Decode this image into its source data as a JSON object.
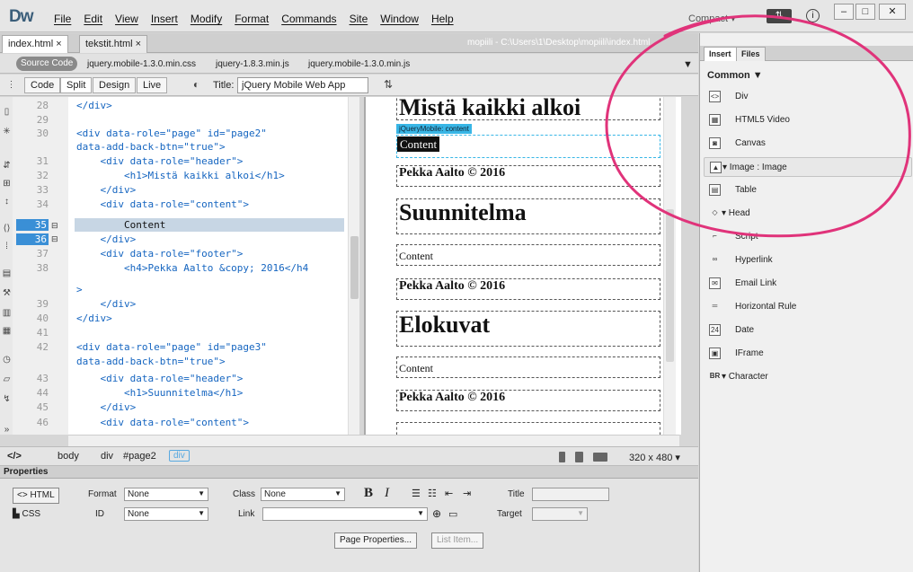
{
  "app": {
    "logo": "Dw",
    "menus": [
      "File",
      "Edit",
      "View",
      "Insert",
      "Modify",
      "Format",
      "Commands",
      "Site",
      "Window",
      "Help"
    ],
    "workspace": "Compact ▾",
    "sync": "⇅",
    "info": "i",
    "window_controls": [
      "–",
      "□",
      "✕"
    ]
  },
  "doc": {
    "tabs": [
      "index.html ×",
      "tekstit.html ×"
    ],
    "path": "mopiili - C:\\Users\\1\\Desktop\\mopiili\\index.html",
    "source_button": "Source Code",
    "related_files": [
      "jquery.mobile-1.3.0.min.css",
      "jquery-1.8.3.min.js",
      "jquery.mobile-1.3.0.min.js"
    ],
    "view_buttons": [
      "Code",
      "Split",
      "Design",
      "Live"
    ],
    "title_label": "Title:",
    "title_value": "jQuery Mobile Web App"
  },
  "code": {
    "line_numbers": [
      "28",
      "29",
      "30",
      "",
      "31",
      "32",
      "33",
      "34",
      "35",
      "36",
      "37",
      "38",
      "",
      "39",
      "40",
      "41",
      "42",
      "",
      "43",
      "44",
      "45",
      "46"
    ],
    "lines": [
      "</div>",
      "",
      "<div data-role=\"page\" id=\"page2\"",
      "data-add-back-btn=\"true\">",
      "    <div data-role=\"header\">",
      "        <h1>Mistä kaikki alkoi</h1>",
      "    </div>",
      "    <div data-role=\"content\">",
      "        Content",
      "    </div>",
      "    <div data-role=\"footer\">",
      "        <h4>Pekka Aalto &copy; 2016</h4",
      ">",
      "    </div>",
      "</div>",
      "",
      "<div data-role=\"page\" id=\"page3\"",
      "data-add-back-btn=\"true\">",
      "    <div data-role=\"header\">",
      "        <h1>Suunnitelma</h1>",
      "    </div>",
      "    <div data-role=\"content\">"
    ]
  },
  "design": {
    "heading1": "Mistä kaikki alkoi",
    "jq_label": "jQueryMobile: content",
    "content": "Content",
    "footer": "Pekka Aalto © 2016",
    "heading2": "Suunnitelma",
    "heading3": "Elokuvat"
  },
  "tagbar": {
    "tags": [
      "</>",
      "body",
      "div",
      "#page2"
    ],
    "selected": "div",
    "size": "320 x 480 ▾"
  },
  "properties": {
    "title": "Properties",
    "html_label": "<> HTML",
    "css_label": "CSS",
    "format_label": "Format",
    "format_value": "None",
    "class_label": "Class",
    "class_value": "None",
    "id_label": "ID",
    "id_value": "None",
    "link_label": "Link",
    "title_label": "Title",
    "target_label": "Target",
    "bold": "B",
    "italic": "I",
    "page_properties": "Page Properties...",
    "list_item": "List Item..."
  },
  "panel": {
    "tabs": [
      "Insert",
      "Files"
    ],
    "category": "Common ▼",
    "items": [
      {
        "icon": "div-icon",
        "glyph": "<>",
        "label": "Div"
      },
      {
        "icon": "video-icon",
        "glyph": "▦",
        "label": "HTML5 Video"
      },
      {
        "icon": "canvas-icon",
        "glyph": "◙",
        "label": "Canvas"
      },
      {
        "icon": "image-icon",
        "glyph": "▲",
        "label": "▾ Image : Image"
      },
      {
        "icon": "table-icon",
        "glyph": "▤",
        "label": "Table"
      },
      {
        "icon": "head-icon",
        "glyph": "◇",
        "label": "▾ Head"
      },
      {
        "icon": "script-icon",
        "glyph": "⌐",
        "label": "Script"
      },
      {
        "icon": "hyperlink-icon",
        "glyph": "∞",
        "label": "Hyperlink"
      },
      {
        "icon": "email-icon",
        "glyph": "✉",
        "label": "Email Link"
      },
      {
        "icon": "hr-icon",
        "glyph": "═",
        "label": "Horizontal Rule"
      },
      {
        "icon": "date-icon",
        "glyph": "24",
        "label": "Date"
      },
      {
        "icon": "iframe-icon",
        "glyph": "▣",
        "label": "IFrame"
      },
      {
        "icon": "character-icon",
        "glyph": "BR",
        "label": "▾ Character"
      }
    ]
  },
  "colors": {
    "annotation": "#e0337a",
    "accent": "#3a8fd6"
  }
}
